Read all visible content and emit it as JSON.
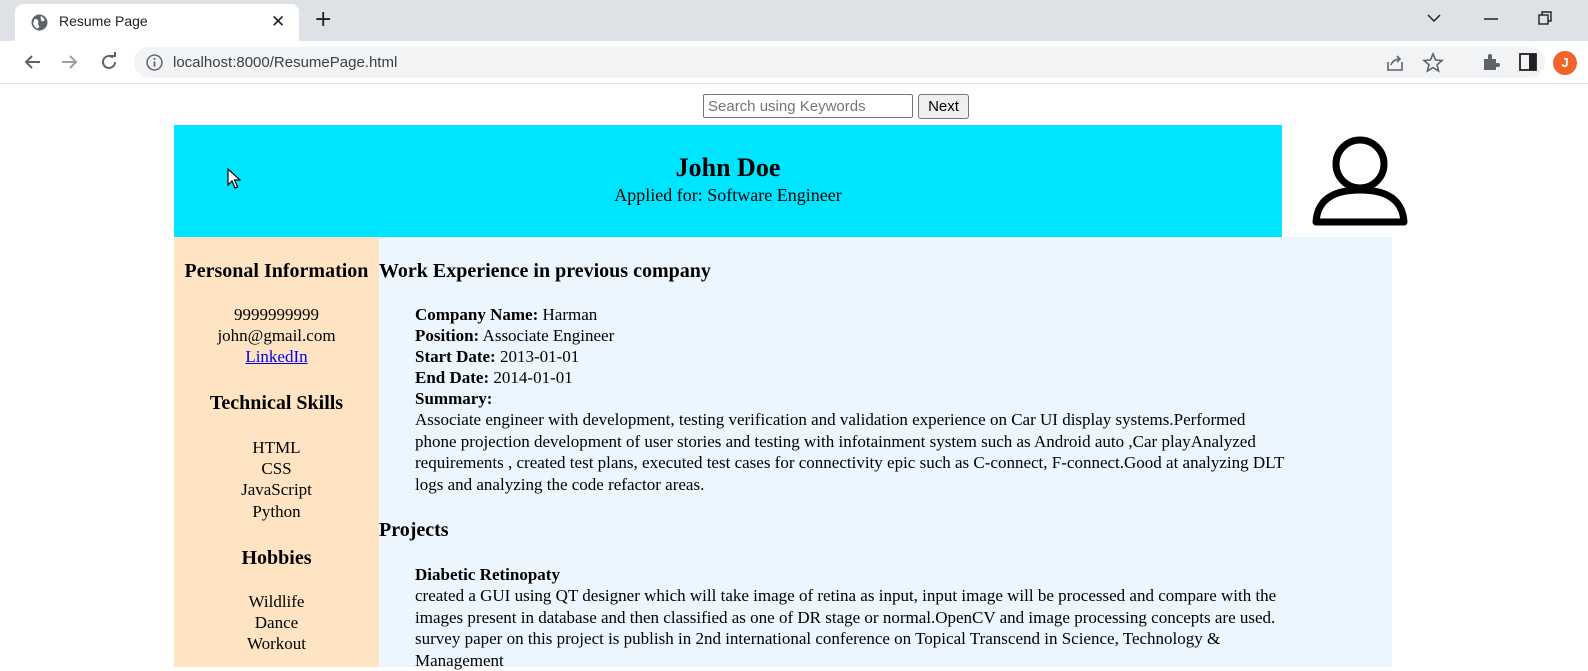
{
  "browser": {
    "tab_title": "Resume Page",
    "url": "localhost:8000/ResumePage.html",
    "profile_initial": "J",
    "profile_color": "#f0632b"
  },
  "search": {
    "placeholder": "Search using Keywords",
    "next_label": "Next"
  },
  "header": {
    "name": "John Doe",
    "applied_for": "Applied for: Software Engineer",
    "bg_color": "#00e5ff"
  },
  "sidebar": {
    "bg_color": "#ffe4c4",
    "personal_heading": "Personal Information",
    "phone": "9999999999",
    "email": "john@gmail.com",
    "linkedin": "LinkedIn",
    "skills_heading": "Technical Skills",
    "skills": [
      "HTML",
      "CSS",
      "JavaScript",
      "Python"
    ],
    "hobbies_heading": "Hobbies",
    "hobbies": [
      "Wildlife",
      "Dance",
      "Workout"
    ]
  },
  "work": {
    "heading": "Work Experience in previous company",
    "company_label": "Company Name:",
    "company": "Harman",
    "position_label": "Position:",
    "position": "Associate Engineer",
    "start_label": "Start Date:",
    "start": "2013-01-01",
    "end_label": "End Date:",
    "end": "2014-01-01",
    "summary_label": "Summary:",
    "summary_lines": [
      "Associate engineer with development, testing verification and validation experience on Car UI display systems.Performed",
      "phone projection development of user stories and testing with infotainment system such as Android auto ,Car playAnalyzed",
      "requirements , created test plans, executed test cases for connectivity epic such as C-connect, F-connect.Good at analyzing DLT",
      "logs and analyzing the code refactor areas."
    ]
  },
  "projects": {
    "heading": "Projects",
    "project_title": "Diabetic Retinopaty",
    "description_lines": [
      "created a GUI using QT designer which will take image of retina as input, input image will be processed and compare with the",
      "images present in database and then classified as one of DR stage or normal.OpenCV and image processing concepts are used.",
      "survey paper on this project is publish in 2nd international conference on Topical Transcend in Science, Technology &",
      "Management"
    ]
  }
}
